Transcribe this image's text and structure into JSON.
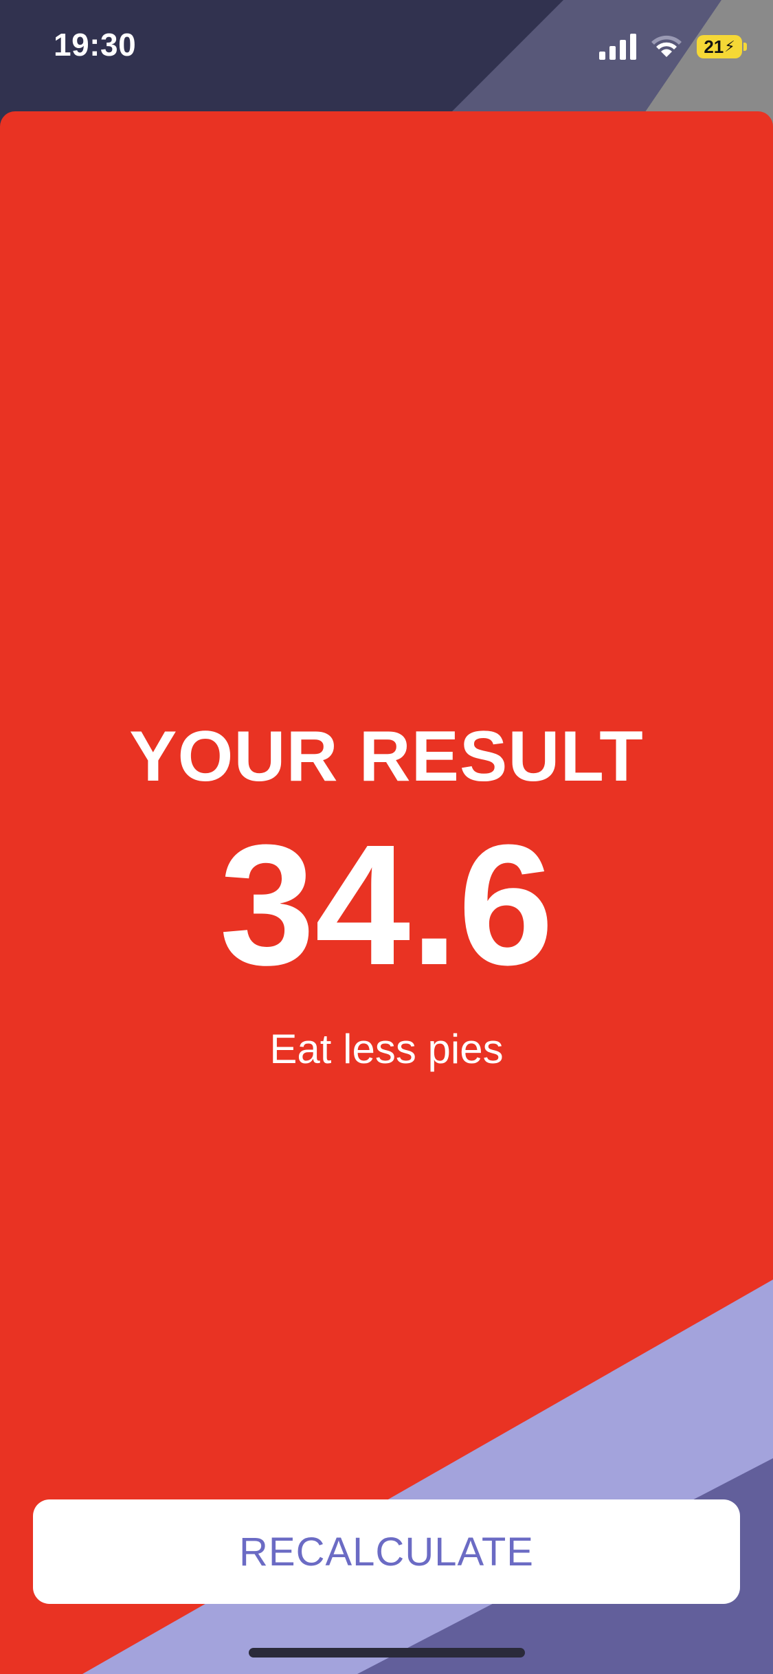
{
  "status_bar": {
    "time": "19:30",
    "battery_level": "21",
    "icons": [
      "signal-icon",
      "wifi-icon",
      "battery-icon",
      "charging-bolt-icon"
    ]
  },
  "result": {
    "heading": "YOUR RESULT",
    "value": "34.6",
    "message": "Eat less pies"
  },
  "actions": {
    "recalculate_label": "RECALCULATE"
  },
  "colors": {
    "background": "#31324f",
    "card": "#e93323",
    "stripe_light": "#a3a3dc",
    "stripe_dark": "#625f9b",
    "button_bg": "#ffffff",
    "button_text": "#6b6bc4",
    "battery": "#f5d836"
  }
}
